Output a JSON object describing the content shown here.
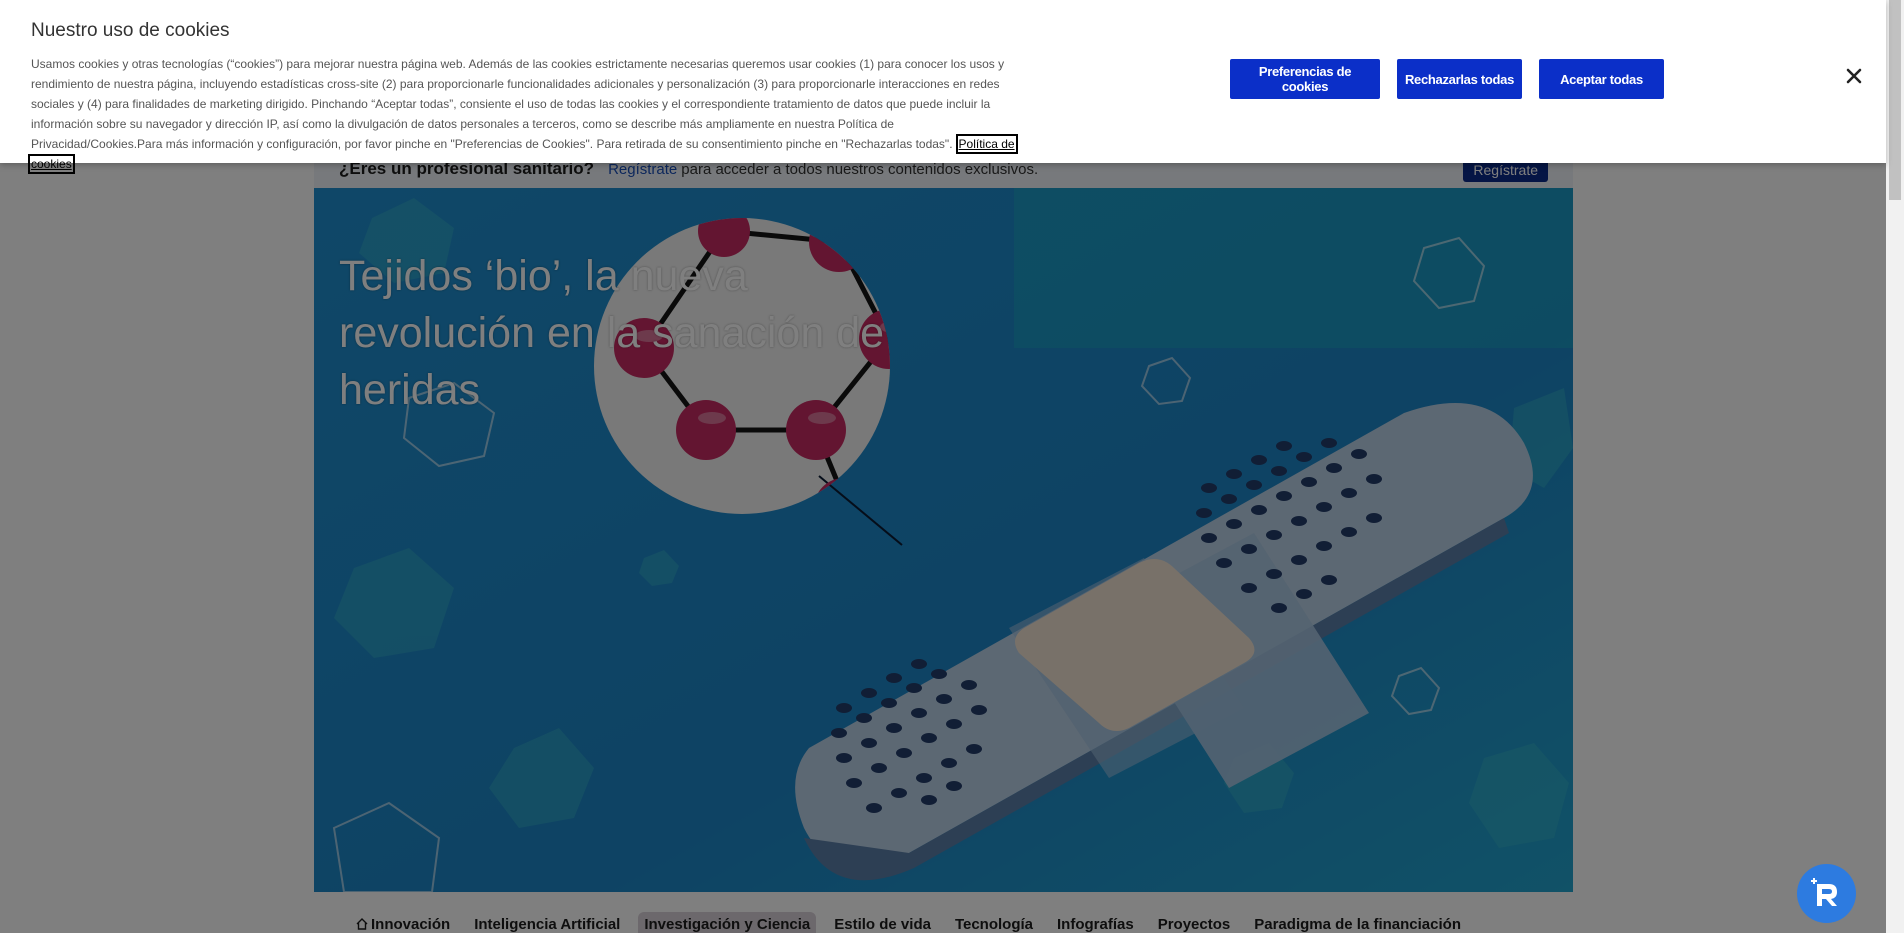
{
  "cookie_banner": {
    "title": "Nuestro uso de cookies",
    "text": "Usamos cookies y otras tecnologías (“cookies”) para mejorar nuestra página web. Además de las cookies estrictamente necesarias queremos usar cookies (1) para conocer los usos y rendimiento de nuestra página, incluyendo estadísticas cross-site (2) para proporcionarle funcionalidades adicionales y personalización (3) para proporcionarle interacciones en redes sociales y (4) para finalidades de marketing dirigido. Pinchando “Aceptar todas”, consiente el uso de todas las cookies y el correspondiente tratamiento de datos que puede incluir la información sobre su navegador y dirección IP, así como la divulgación de datos personales a terceros, como se describe más ampliamente en nuestra Política de Privacidad/Cookies.Para más información y configuración, por favor pinche en \"Preferencias de Cookies\". Para retirada de su consentimiento pinche en \"Rechazarlas todas\".",
    "policy_link": "Política de cookies",
    "buttons": {
      "preferences": "Preferencias de cookies",
      "reject_all": "Rechazarlas todas",
      "accept_all": "Aceptar todas"
    },
    "close_icon": "close-icon",
    "button_color": "#0b2fc8"
  },
  "pro_bar": {
    "question": "¿Eres un profesional sanitario?",
    "register_link": "Regístrate",
    "rest": "para acceder a todos nuestros contenidos exclusivos.",
    "register_button": "Regístrate"
  },
  "hero": {
    "title": "Tejidos ‘bio’, la nueva revolución en la sanación de heridas",
    "illustration": "bandage-molecule-illustration"
  },
  "menu": {
    "home_icon": "home-icon",
    "items": [
      "Innovación",
      "Inteligencia Artificial",
      "Investigación y Ciencia",
      "Estilo de vida",
      "Tecnología",
      "Infografías",
      "Proyectos",
      "Paradigma de la financiación"
    ],
    "active_index": 2
  },
  "assistant": {
    "icon": "assistant-icon"
  }
}
